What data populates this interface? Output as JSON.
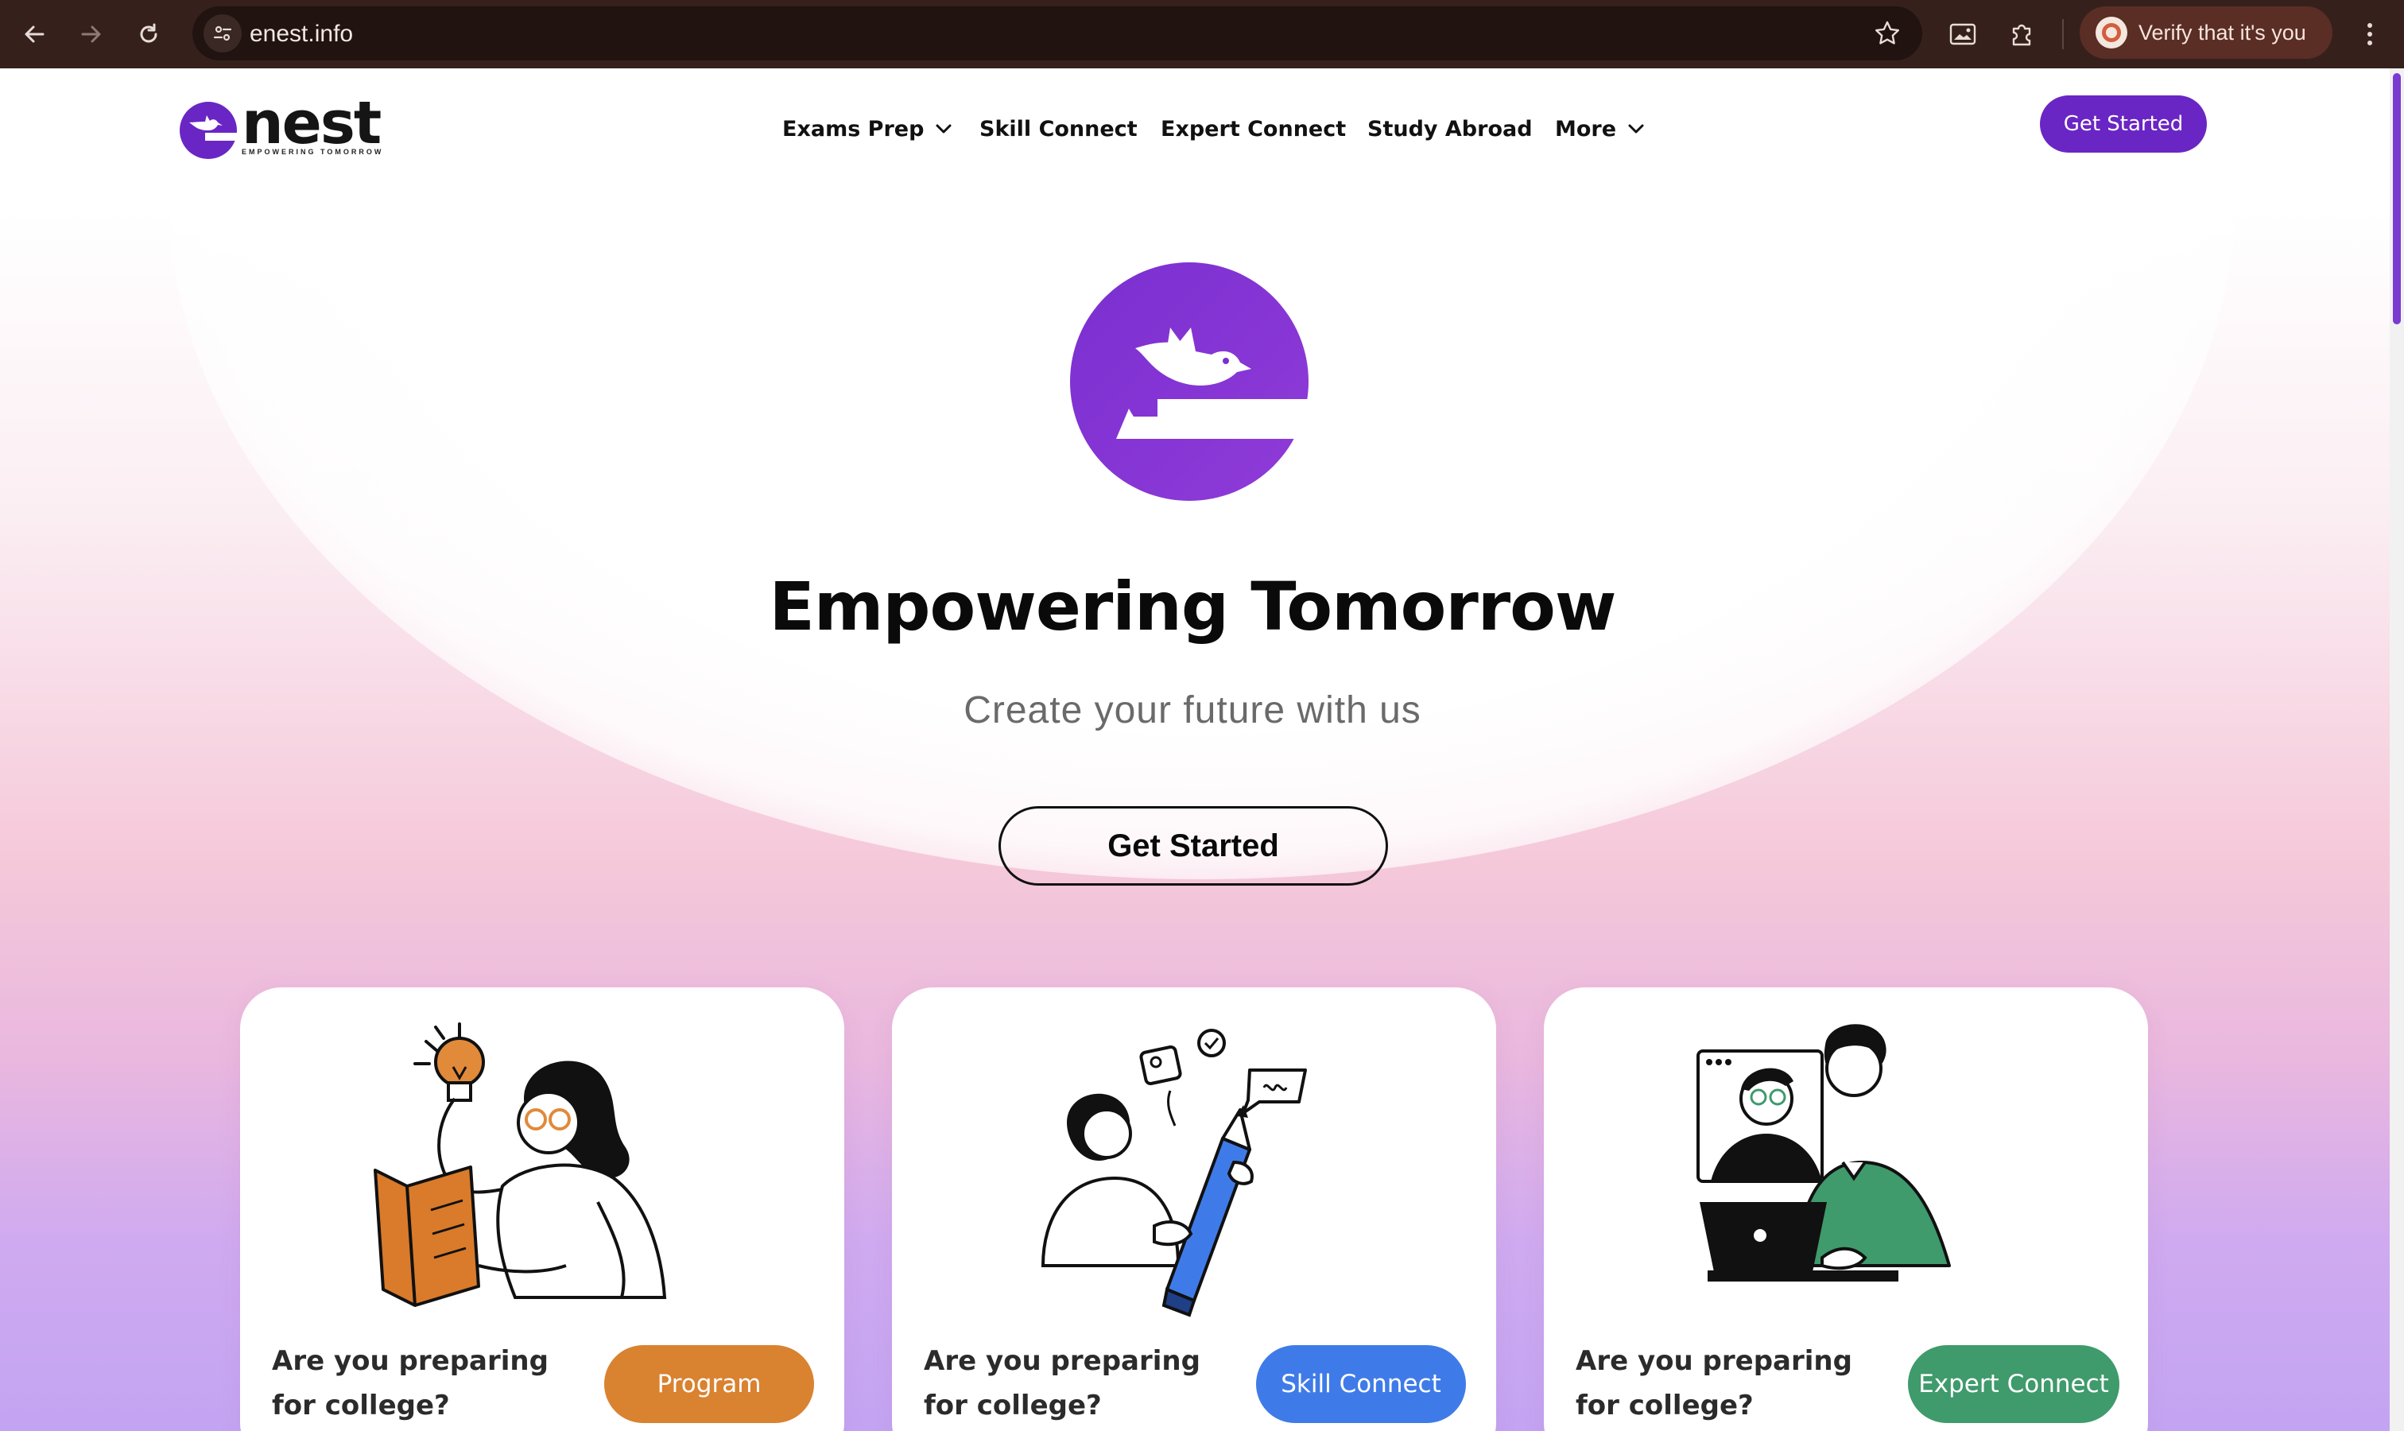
{
  "browser": {
    "url": "enest.info",
    "verify_label": "Verify that it's you",
    "icons": [
      "back-arrow-icon",
      "forward-arrow-icon",
      "reload-icon",
      "site-info-icon",
      "bookmark-star-icon",
      "picture-in-picture-icon",
      "extensions-puzzle-icon",
      "kebab-menu-icon"
    ]
  },
  "header": {
    "logo_word": "nest",
    "logo_tagline": "EMPOWERING TOMORROW",
    "nav": [
      {
        "label": "Exams Prep",
        "has_dropdown": true
      },
      {
        "label": "Skill Connect",
        "has_dropdown": false
      },
      {
        "label": "Expert Connect",
        "has_dropdown": false
      },
      {
        "label": "Study Abroad",
        "has_dropdown": false
      },
      {
        "label": "More",
        "has_dropdown": true
      }
    ],
    "cta_label": "Get Started"
  },
  "hero": {
    "title": "Empowering Tomorrow",
    "subtitle": "Create your future with us",
    "cta_label": "Get Started"
  },
  "cards": [
    {
      "question": "Are you preparing for college?",
      "button_label": "Program",
      "button_color": "#d98230",
      "illustration": "woman-reading-lightbulb"
    },
    {
      "question": "Are you preparing for college?",
      "button_label": "Skill Connect",
      "button_color": "#3f7be8",
      "illustration": "woman-pencil-ideas"
    },
    {
      "question": "Are you preparing for college?",
      "button_label": "Expert Connect",
      "button_color": "#3f9a6c",
      "illustration": "expert-video-call-laptop"
    }
  ],
  "colors": {
    "brand_purple": "#6a26c4",
    "chrome_bg": "#35201c"
  }
}
